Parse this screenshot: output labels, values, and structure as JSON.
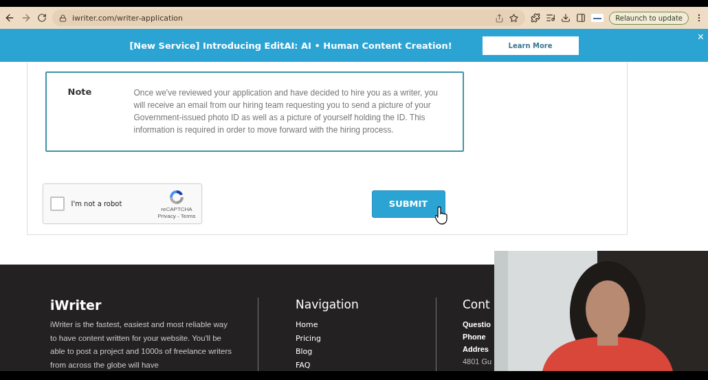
{
  "browser": {
    "url": "iwriter.com/writer-application",
    "relaunch_button": "Relaunch to update"
  },
  "banner": {
    "text": "[New Service] Introducing EditAI: AI • Human Content Creation!",
    "button": "Learn More",
    "close": "×"
  },
  "note": {
    "label": "Note",
    "text": "Once we've reviewed your application and have decided to hire you as a writer, you will receive an email from our hiring team requesting you to send a picture of your Government-issued photo ID as well as a picture of yourself holding the ID. This information is required in order to move forward with the hiring process."
  },
  "captcha": {
    "label": "I'm not a robot",
    "checked": false,
    "brand": "reCAPTCHA",
    "links": "Privacy - Terms"
  },
  "submit_button": "SUBMIT",
  "footer": {
    "logo": "iWriter",
    "description": "iWriter is the fastest, easiest and most reliable way to have content written for your website. You'll be able to post a project and 1000s of freelance writers from across the globe will have",
    "navigation": {
      "title": "Navigation",
      "links": [
        "Home",
        "Pricing",
        "Blog",
        "FAQ"
      ]
    },
    "contact": {
      "title": "Cont",
      "lines": [
        {
          "text": "Questio",
          "kind": "bold"
        },
        {
          "text": "Phone",
          "kind": "bold"
        },
        {
          "text": "Addres",
          "kind": "bold"
        },
        {
          "text": "4801 Gu",
          "kind": "plain"
        }
      ]
    }
  }
}
